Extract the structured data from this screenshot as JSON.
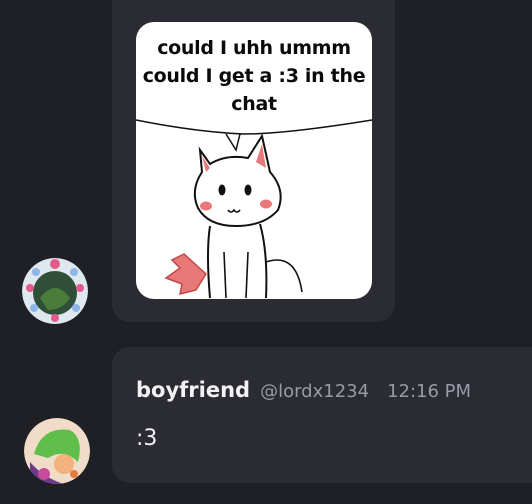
{
  "colors": {
    "background": "#1f1f26",
    "bubble": "#2b2b33",
    "username": "#f2f2f5",
    "muted": "#9a9aa6"
  },
  "meme": {
    "caption_line1": "could I uhh ummm",
    "caption_line2": "could I get a :3 in the",
    "caption_line3": "chat"
  },
  "avatars": {
    "first": "avatar-icon",
    "second": "avatar-icon"
  },
  "message": {
    "username": "boyfriend",
    "handle": "@lordx1234",
    "timestamp": "12:16 PM",
    "text": ":3"
  }
}
